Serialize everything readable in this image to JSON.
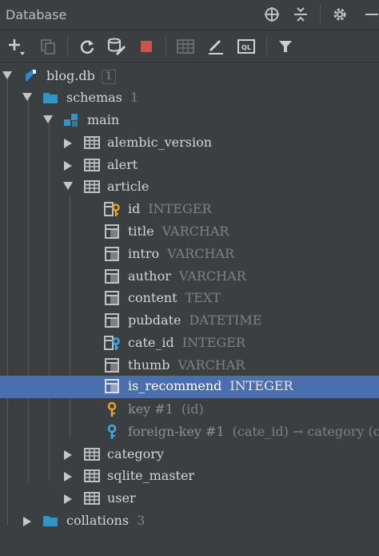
{
  "window": {
    "title": "Database"
  },
  "tree": {
    "blogdb": {
      "label": "blog.db",
      "badge": "1"
    },
    "schemas": {
      "label": "schemas",
      "count": "1"
    },
    "main": {
      "label": "main"
    },
    "tables": {
      "alembic_version": "alembic_version",
      "alert": "alert",
      "article": "article",
      "category": "category",
      "sqlite_master": "sqlite_master",
      "user": "user"
    },
    "columns": [
      {
        "name": "id",
        "type": "INTEGER"
      },
      {
        "name": "title",
        "type": "VARCHAR"
      },
      {
        "name": "intro",
        "type": "VARCHAR"
      },
      {
        "name": "author",
        "type": "VARCHAR"
      },
      {
        "name": "content",
        "type": "TEXT"
      },
      {
        "name": "pubdate",
        "type": "DATETIME"
      },
      {
        "name": "cate_id",
        "type": "INTEGER"
      },
      {
        "name": "thumb",
        "type": "VARCHAR"
      },
      {
        "name": "is_recommend",
        "type": "INTEGER"
      }
    ],
    "key": {
      "label": "key #1",
      "detail": "(id)"
    },
    "foreign_key": {
      "label": "foreign-key #1",
      "detail": "(cate_id) → category (cate_"
    },
    "collations": {
      "label": "collations",
      "count": "3"
    }
  }
}
